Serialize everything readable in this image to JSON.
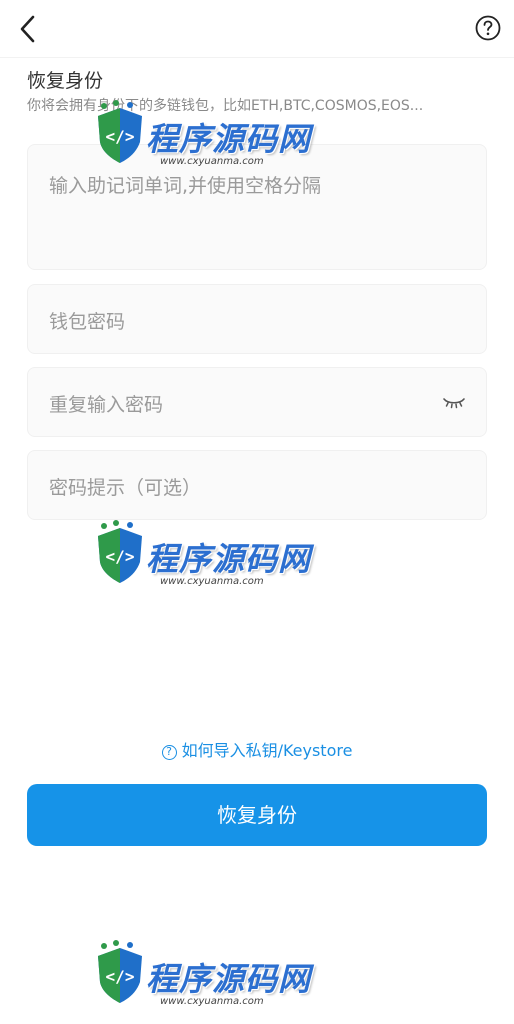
{
  "header": {
    "back_icon": "chevron-left-icon",
    "help_icon": "question-circle-icon"
  },
  "page": {
    "title": "恢复身份",
    "subtitle": "你将会拥有身份下的多链钱包，比如ETH,BTC,COSMOS,EOS..."
  },
  "form": {
    "mnemonic_placeholder": "输入助记词单词,并使用空格分隔",
    "password_placeholder": "钱包密码",
    "repeat_password_placeholder": "重复输入密码",
    "password_hint_placeholder": "密码提示（可选）",
    "eye_icon": "eye-closed-icon"
  },
  "import_link": {
    "icon": "question-circle-icon",
    "label": "如何导入私钥/Keystore"
  },
  "primary_button": {
    "label": "恢复身份"
  },
  "watermark": {
    "brand": "程序源码网",
    "url": "www.cxyuanma.com"
  },
  "colors": {
    "accent": "#1693e8",
    "link": "#1a8fe3",
    "placeholder": "#9a9a9a",
    "field_bg": "#fafafa"
  }
}
